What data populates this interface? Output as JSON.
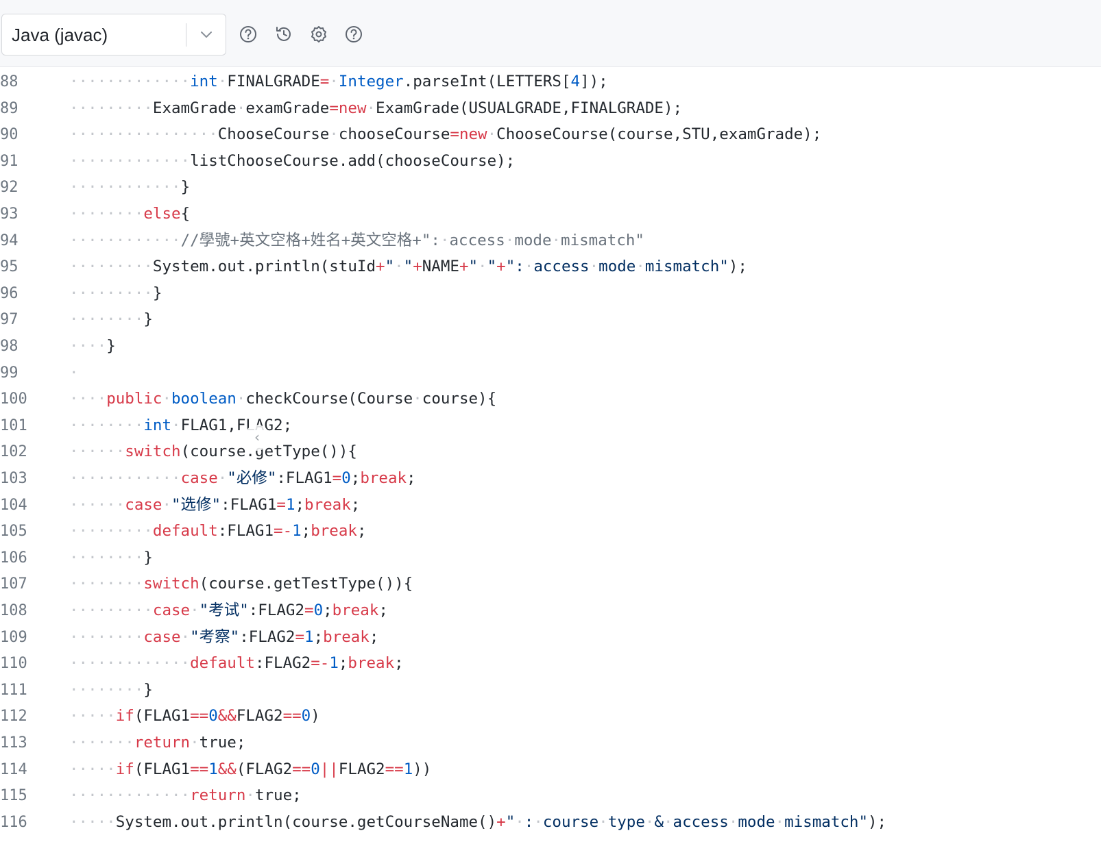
{
  "toolbar": {
    "language_select": {
      "value": "Java (javac)"
    },
    "icons": [
      "help-circle-icon",
      "history-icon",
      "settings-gear-icon",
      "help-circle-icon"
    ]
  },
  "editor": {
    "collapse_glyph": "‹",
    "lines": [
      {
        "n": "88",
        "tokens": [
          [
            "d",
            "·············"
          ],
          [
            "t",
            "int"
          ],
          [
            "d",
            "·"
          ],
          [
            "p",
            "FINALGRADE"
          ],
          [
            "o",
            "="
          ],
          [
            "d",
            "·"
          ],
          [
            "t",
            "Integer"
          ],
          [
            "p",
            ".parseInt(LETTERS["
          ],
          [
            "n",
            "4"
          ],
          [
            "p",
            "]);"
          ]
        ]
      },
      {
        "n": "89",
        "tokens": [
          [
            "d",
            "·········"
          ],
          [
            "p",
            "ExamGrade"
          ],
          [
            "d",
            "·"
          ],
          [
            "p",
            "examGrade"
          ],
          [
            "o",
            "="
          ],
          [
            "k",
            "new"
          ],
          [
            "d",
            "·"
          ],
          [
            "p",
            "ExamGrade(USUALGRADE,FINALGRADE);"
          ]
        ]
      },
      {
        "n": "90",
        "tokens": [
          [
            "d",
            "················"
          ],
          [
            "p",
            "ChooseCourse"
          ],
          [
            "d",
            "·"
          ],
          [
            "p",
            "chooseCourse"
          ],
          [
            "o",
            "="
          ],
          [
            "k",
            "new"
          ],
          [
            "d",
            "·"
          ],
          [
            "p",
            "ChooseCourse(course,STU,examGrade);"
          ]
        ]
      },
      {
        "n": "91",
        "tokens": [
          [
            "d",
            "·············"
          ],
          [
            "p",
            "listChooseCourse.add(chooseCourse);"
          ]
        ]
      },
      {
        "n": "92",
        "tokens": [
          [
            "d",
            "············"
          ],
          [
            "p",
            "}"
          ]
        ]
      },
      {
        "n": "93",
        "tokens": [
          [
            "d",
            "········"
          ],
          [
            "k",
            "else"
          ],
          [
            "p",
            "{"
          ]
        ]
      },
      {
        "n": "94",
        "tokens": [
          [
            "d",
            "············"
          ],
          [
            "c",
            "//學號+英文空格+姓名+英文空格+\":"
          ],
          [
            "d",
            "·"
          ],
          [
            "c",
            "access"
          ],
          [
            "d",
            "·"
          ],
          [
            "c",
            "mode"
          ],
          [
            "d",
            "·"
          ],
          [
            "c",
            "mismatch\""
          ]
        ]
      },
      {
        "n": "95",
        "tokens": [
          [
            "d",
            "·········"
          ],
          [
            "p",
            "System.out.println(stuId"
          ],
          [
            "o",
            "+"
          ],
          [
            "s",
            "\""
          ],
          [
            "d",
            "·"
          ],
          [
            "s",
            "\""
          ],
          [
            "o",
            "+"
          ],
          [
            "p",
            "NAME"
          ],
          [
            "o",
            "+"
          ],
          [
            "s",
            "\""
          ],
          [
            "d",
            "·"
          ],
          [
            "s",
            "\""
          ],
          [
            "o",
            "+"
          ],
          [
            "s",
            "\":"
          ],
          [
            "d",
            "·"
          ],
          [
            "s",
            "access"
          ],
          [
            "d",
            "·"
          ],
          [
            "s",
            "mode"
          ],
          [
            "d",
            "·"
          ],
          [
            "s",
            "mismatch\""
          ],
          [
            "p",
            ");"
          ]
        ]
      },
      {
        "n": "96",
        "tokens": [
          [
            "d",
            "·········"
          ],
          [
            "p",
            "}"
          ]
        ]
      },
      {
        "n": "97",
        "tokens": [
          [
            "d",
            "········"
          ],
          [
            "p",
            "}"
          ]
        ]
      },
      {
        "n": "98",
        "tokens": [
          [
            "d",
            "····"
          ],
          [
            "p",
            "}"
          ]
        ]
      },
      {
        "n": "99",
        "tokens": [
          [
            "d",
            "·"
          ]
        ]
      },
      {
        "n": "100",
        "tokens": [
          [
            "d",
            "····"
          ],
          [
            "k",
            "public"
          ],
          [
            "d",
            "·"
          ],
          [
            "t",
            "boolean"
          ],
          [
            "d",
            "·"
          ],
          [
            "p",
            "checkCourse(Course"
          ],
          [
            "d",
            "·"
          ],
          [
            "p",
            "course){"
          ]
        ]
      },
      {
        "n": "101",
        "tokens": [
          [
            "d",
            "········"
          ],
          [
            "t",
            "int"
          ],
          [
            "d",
            "·"
          ],
          [
            "p",
            "FLAG1,FLAG2;"
          ]
        ]
      },
      {
        "n": "102",
        "tokens": [
          [
            "d",
            "······"
          ],
          [
            "k",
            "switch"
          ],
          [
            "p",
            "(course.getType()){"
          ]
        ]
      },
      {
        "n": "103",
        "tokens": [
          [
            "d",
            "············"
          ],
          [
            "k",
            "case"
          ],
          [
            "d",
            "·"
          ],
          [
            "s",
            "\"必修\""
          ],
          [
            "p",
            ":FLAG1"
          ],
          [
            "o",
            "="
          ],
          [
            "n",
            "0"
          ],
          [
            "p",
            ";"
          ],
          [
            "k",
            "break"
          ],
          [
            "p",
            ";"
          ]
        ]
      },
      {
        "n": "104",
        "tokens": [
          [
            "d",
            "······"
          ],
          [
            "k",
            "case"
          ],
          [
            "d",
            "·"
          ],
          [
            "s",
            "\"选修\""
          ],
          [
            "p",
            ":FLAG1"
          ],
          [
            "o",
            "="
          ],
          [
            "n",
            "1"
          ],
          [
            "p",
            ";"
          ],
          [
            "k",
            "break"
          ],
          [
            "p",
            ";"
          ]
        ]
      },
      {
        "n": "105",
        "tokens": [
          [
            "d",
            "·········"
          ],
          [
            "k",
            "default"
          ],
          [
            "p",
            ":FLAG1"
          ],
          [
            "o",
            "=-"
          ],
          [
            "n",
            "1"
          ],
          [
            "p",
            ";"
          ],
          [
            "k",
            "break"
          ],
          [
            "p",
            ";"
          ]
        ]
      },
      {
        "n": "106",
        "tokens": [
          [
            "d",
            "········"
          ],
          [
            "p",
            "}"
          ]
        ]
      },
      {
        "n": "107",
        "tokens": [
          [
            "d",
            "········"
          ],
          [
            "k",
            "switch"
          ],
          [
            "p",
            "(course.getTestType()){"
          ]
        ]
      },
      {
        "n": "108",
        "tokens": [
          [
            "d",
            "·········"
          ],
          [
            "k",
            "case"
          ],
          [
            "d",
            "·"
          ],
          [
            "s",
            "\"考试\""
          ],
          [
            "p",
            ":FLAG2"
          ],
          [
            "o",
            "="
          ],
          [
            "n",
            "0"
          ],
          [
            "p",
            ";"
          ],
          [
            "k",
            "break"
          ],
          [
            "p",
            ";"
          ]
        ]
      },
      {
        "n": "109",
        "tokens": [
          [
            "d",
            "········"
          ],
          [
            "k",
            "case"
          ],
          [
            "d",
            "·"
          ],
          [
            "s",
            "\"考察\""
          ],
          [
            "p",
            ":FLAG2"
          ],
          [
            "o",
            "="
          ],
          [
            "n",
            "1"
          ],
          [
            "p",
            ";"
          ],
          [
            "k",
            "break"
          ],
          [
            "p",
            ";"
          ]
        ]
      },
      {
        "n": "110",
        "tokens": [
          [
            "d",
            "·············"
          ],
          [
            "k",
            "default"
          ],
          [
            "p",
            ":FLAG2"
          ],
          [
            "o",
            "=-"
          ],
          [
            "n",
            "1"
          ],
          [
            "p",
            ";"
          ],
          [
            "k",
            "break"
          ],
          [
            "p",
            ";"
          ]
        ]
      },
      {
        "n": "111",
        "tokens": [
          [
            "d",
            "········"
          ],
          [
            "p",
            "}"
          ]
        ]
      },
      {
        "n": "112",
        "tokens": [
          [
            "d",
            "·····"
          ],
          [
            "k",
            "if"
          ],
          [
            "p",
            "(FLAG1"
          ],
          [
            "o",
            "=="
          ],
          [
            "n",
            "0"
          ],
          [
            "o",
            "&&"
          ],
          [
            "p",
            "FLAG2"
          ],
          [
            "o",
            "=="
          ],
          [
            "n",
            "0"
          ],
          [
            "p",
            ")"
          ]
        ]
      },
      {
        "n": "113",
        "tokens": [
          [
            "d",
            "·······"
          ],
          [
            "k",
            "return"
          ],
          [
            "d",
            "·"
          ],
          [
            "p",
            "true;"
          ]
        ]
      },
      {
        "n": "114",
        "tokens": [
          [
            "d",
            "·····"
          ],
          [
            "k",
            "if"
          ],
          [
            "p",
            "(FLAG1"
          ],
          [
            "o",
            "=="
          ],
          [
            "n",
            "1"
          ],
          [
            "o",
            "&&"
          ],
          [
            "p",
            "(FLAG2"
          ],
          [
            "o",
            "=="
          ],
          [
            "n",
            "0"
          ],
          [
            "o",
            "||"
          ],
          [
            "p",
            "FLAG2"
          ],
          [
            "o",
            "=="
          ],
          [
            "n",
            "1"
          ],
          [
            "p",
            "))"
          ]
        ]
      },
      {
        "n": "115",
        "tokens": [
          [
            "d",
            "·············"
          ],
          [
            "k",
            "return"
          ],
          [
            "d",
            "·"
          ],
          [
            "p",
            "true;"
          ]
        ]
      },
      {
        "n": "116",
        "tokens": [
          [
            "d",
            "·····"
          ],
          [
            "p",
            "System.out.println(course.getCourseName()"
          ],
          [
            "o",
            "+"
          ],
          [
            "s",
            "\""
          ],
          [
            "d",
            "·"
          ],
          [
            "s",
            ":"
          ],
          [
            "d",
            "·"
          ],
          [
            "s",
            "course"
          ],
          [
            "d",
            "·"
          ],
          [
            "s",
            "type"
          ],
          [
            "d",
            "·"
          ],
          [
            "s",
            "&"
          ],
          [
            "d",
            "·"
          ],
          [
            "s",
            "access"
          ],
          [
            "d",
            "·"
          ],
          [
            "s",
            "mode"
          ],
          [
            "d",
            "·"
          ],
          [
            "s",
            "mismatch\""
          ],
          [
            "p",
            ");"
          ]
        ]
      }
    ]
  }
}
